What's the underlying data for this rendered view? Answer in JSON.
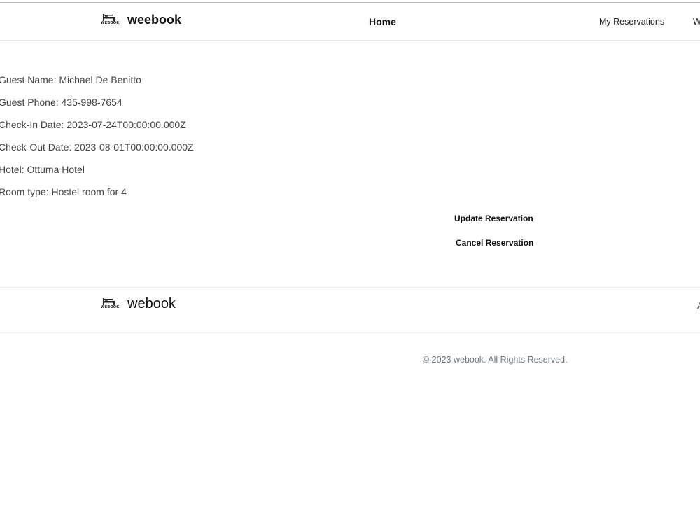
{
  "header": {
    "brand_small": "WEBOOK",
    "brand_name": "weebook",
    "nav": {
      "home": "Home",
      "my_reservations": "My Reservations",
      "cut_item": "W"
    }
  },
  "reservation": {
    "fields": [
      {
        "label": "Guest Name",
        "value": "Michael De Benitto"
      },
      {
        "label": "Guest Phone",
        "value": "435-998-7654"
      },
      {
        "label": "Check-In Date",
        "value": "2023-07-24T00:00:00.000Z"
      },
      {
        "label": "Check-Out Date",
        "value": "2023-08-01T00:00:00.000Z"
      },
      {
        "label": "Hotel",
        "value": "Ottuma Hotel"
      },
      {
        "label": "Room type",
        "value": "Hostel room for 4"
      }
    ],
    "actions": {
      "update": "Update Reservation",
      "cancel": "Cancel Reservation"
    }
  },
  "footer": {
    "brand_small": "WEBOOK",
    "brand_name": "webook",
    "cut_item": "A",
    "copyright": "© 2023 webook. All Rights Reserved."
  },
  "icons": {
    "logo": "bed-icon"
  }
}
